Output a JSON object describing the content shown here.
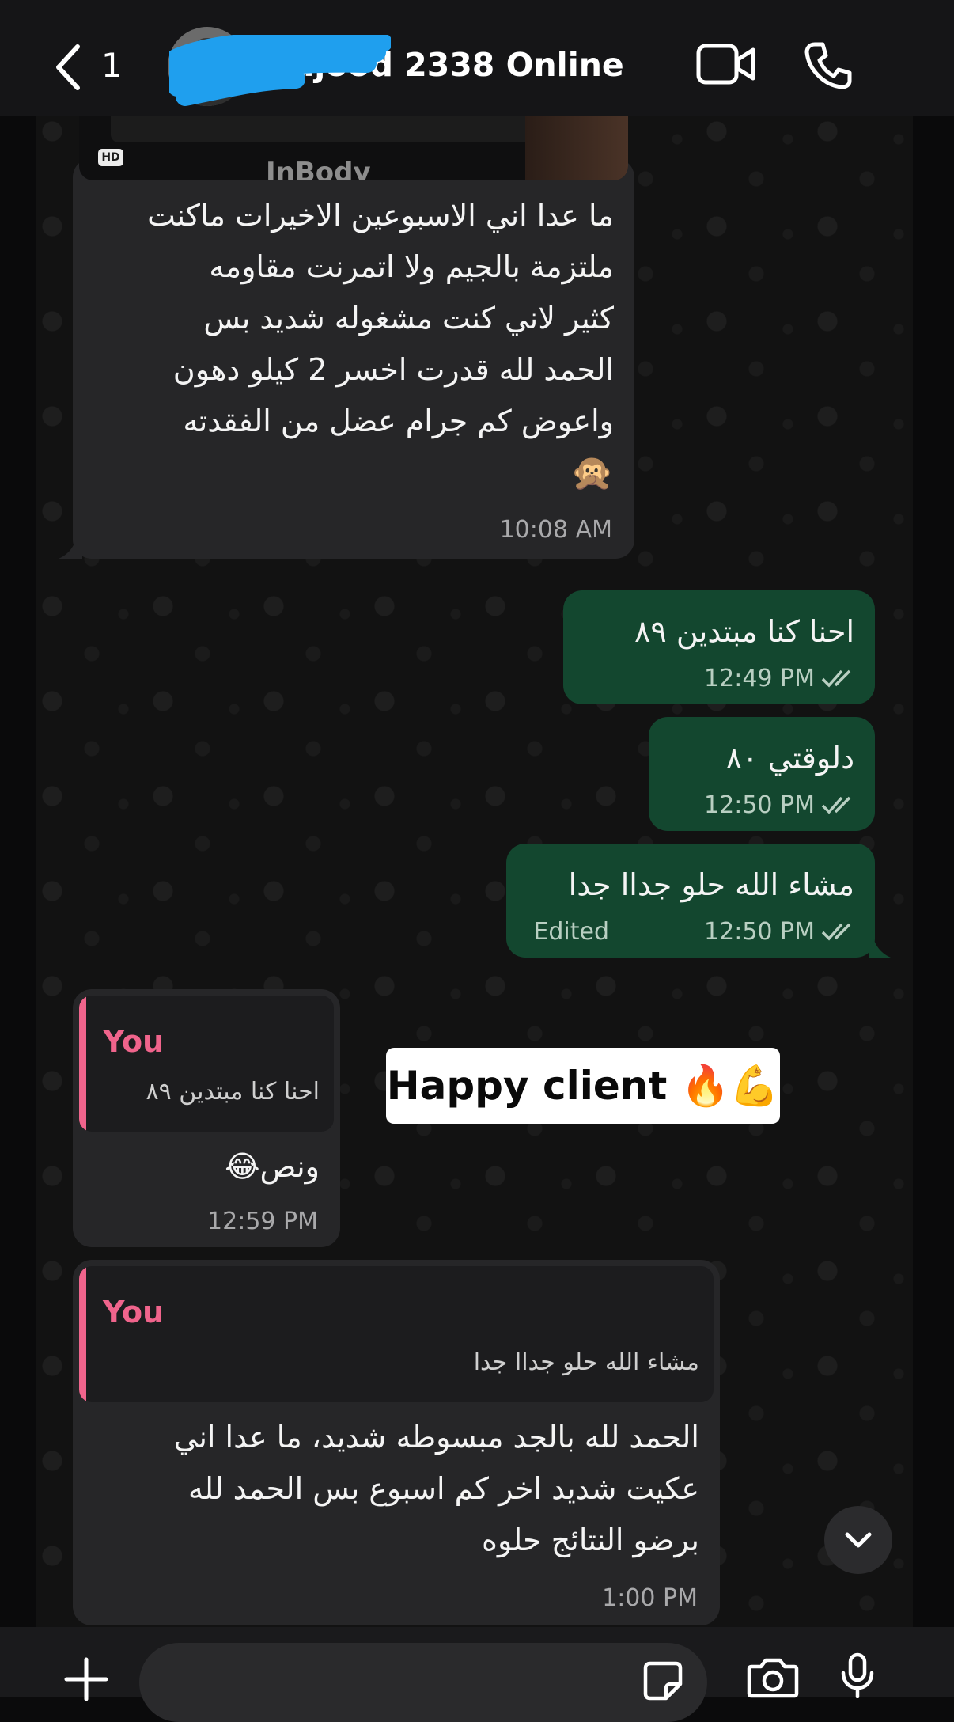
{
  "header": {
    "unread_count": "1",
    "contact_name": "Sajood 2338 Online",
    "icons": {
      "back": "chevron-left-icon",
      "video": "video-camera-icon",
      "call": "phone-icon"
    }
  },
  "image_preview": {
    "badge": "HD",
    "brand_text": "InBody"
  },
  "messages": [
    {
      "direction": "incoming",
      "lines": [
        "ما عدا اني الاسبوعين الاخيرات ماكنت",
        "ملتزمة بالجيم ولا اتمرنت مقاومه",
        "كثير لاني كنت مشغوله شديد بس",
        "الحمد لله قدرت اخسر 2 كيلو دهون",
        "واعوض كم جرام عضل من الفقدته"
      ],
      "emoji": "🙊",
      "time": "10:08 AM"
    },
    {
      "direction": "outgoing",
      "text": "احنا كنا مبتدين  ٨٩",
      "time": "12:49 PM",
      "status": "read"
    },
    {
      "direction": "outgoing",
      "text": "دلوقتي ٨٠",
      "time": "12:50 PM",
      "status": "read"
    },
    {
      "direction": "outgoing",
      "text": "مشاء الله حلو جداا جدا",
      "edited": "Edited",
      "time": "12:50 PM",
      "status": "read"
    },
    {
      "direction": "incoming",
      "reply": {
        "author": "You",
        "text": "احنا كنا مبتدين  ٨٩"
      },
      "text": "ونص😂",
      "time": "12:59 PM"
    },
    {
      "direction": "incoming",
      "reply": {
        "author": "You",
        "text": "مشاء الله حلو جداا جدا"
      },
      "lines": [
        "الحمد لله بالجد مبسوطه شديد، ما عدا اني",
        "عكيت شديد اخر كم اسبوع بس الحمد لله",
        "برضو النتائج حلوه"
      ],
      "time": "1:00 PM"
    }
  ],
  "overlay_sticker": {
    "text": "Happy client 🔥💪"
  },
  "colors": {
    "outgoing_bubble": "#13472f",
    "incoming_bubble": "#262628",
    "reply_accent": "#f0648c"
  },
  "input_bar": {
    "icons": [
      "plus-icon",
      "sticker-icon",
      "camera-icon",
      "microphone-icon"
    ]
  }
}
